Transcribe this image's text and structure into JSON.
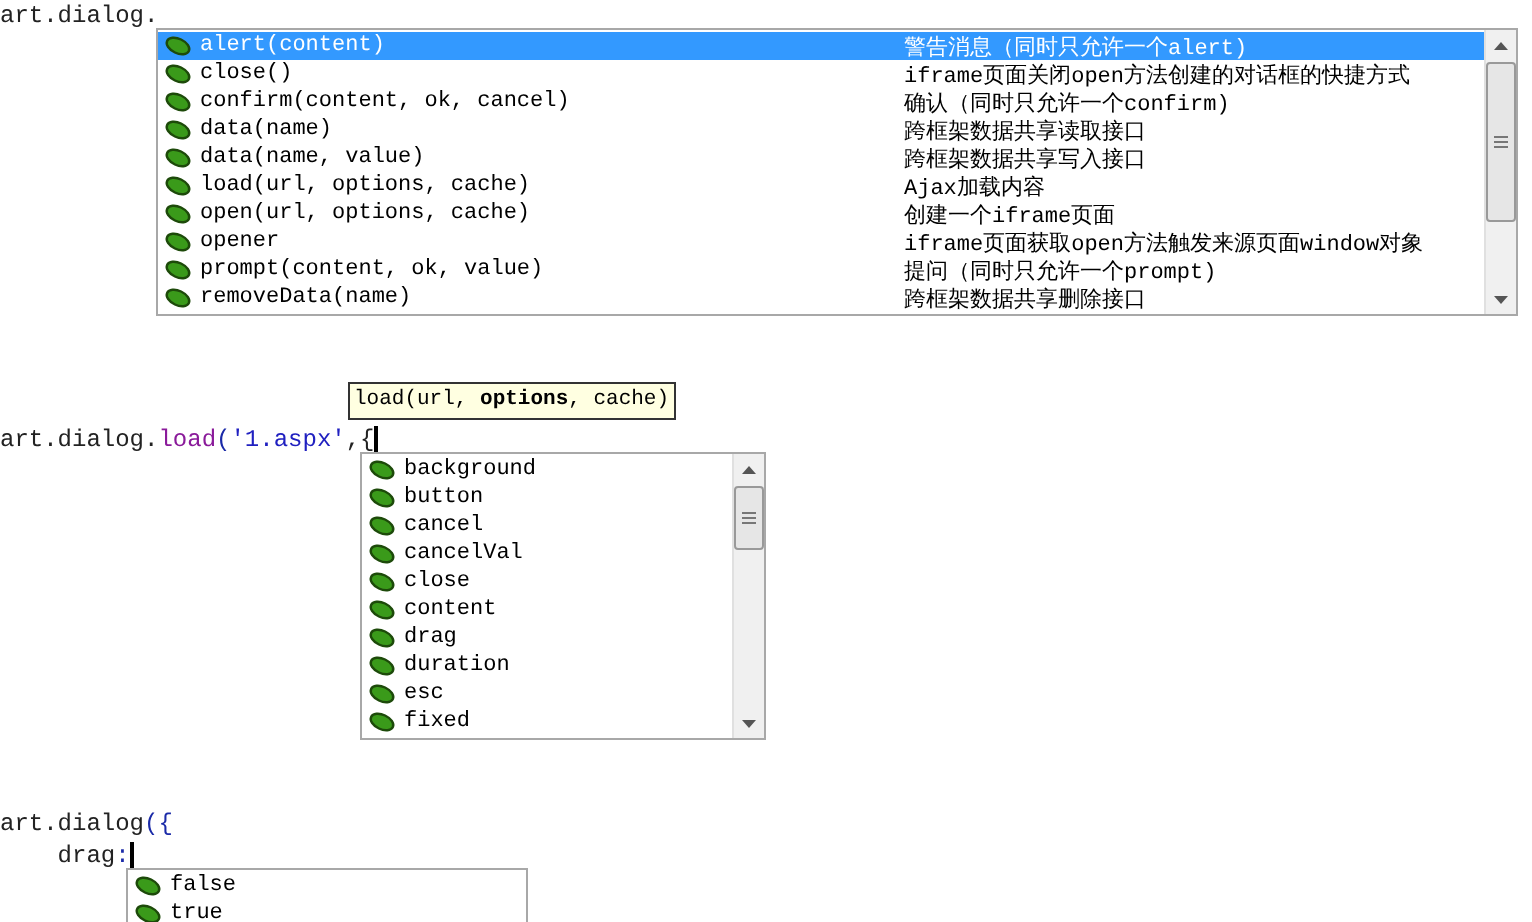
{
  "snippets": [
    {
      "code_lines": [
        [
          {
            "text": "art.dialog.",
            "kind": "plain"
          }
        ]
      ],
      "caret": false,
      "completion": {
        "scrollbar": true,
        "items": [
          {
            "name": "alert(content)",
            "description": "警告消息（同时只允许一个alert)",
            "selected": true
          },
          {
            "name": "close()",
            "description": "iframe页面关闭open方法创建的对话框的快捷方式",
            "selected": false
          },
          {
            "name": "confirm(content, ok, cancel)",
            "description": "确认（同时只允许一个confirm)",
            "selected": false
          },
          {
            "name": "data(name)",
            "description": "跨框架数据共享读取接口",
            "selected": false
          },
          {
            "name": "data(name, value)",
            "description": "跨框架数据共享写入接口",
            "selected": false
          },
          {
            "name": "load(url, options, cache)",
            "description": "Ajax加载内容",
            "selected": false
          },
          {
            "name": "open(url, options, cache)",
            "description": "创建一个iframe页面",
            "selected": false
          },
          {
            "name": "opener",
            "description": "iframe页面获取open方法触发来源页面window对象",
            "selected": false
          },
          {
            "name": "prompt(content, ok, value)",
            "description": "提问（同时只允许一个prompt)",
            "selected": false
          },
          {
            "name": "removeData(name)",
            "description": "跨框架数据共享删除接口",
            "selected": false
          }
        ]
      }
    },
    {
      "tooltip": "load(url, **options**, cache)",
      "code_lines": [
        [
          {
            "text": "art.dialog.",
            "kind": "plain"
          },
          {
            "text": "load",
            "kind": "method"
          },
          {
            "text": "(",
            "kind": "bracket"
          },
          {
            "text": "'1.aspx'",
            "kind": "string"
          },
          {
            "text": ",{",
            "kind": "plain"
          }
        ]
      ],
      "caret": true,
      "completion": {
        "scrollbar": true,
        "items": [
          {
            "name": "background",
            "selected": false
          },
          {
            "name": "button",
            "selected": false
          },
          {
            "name": "cancel",
            "selected": false
          },
          {
            "name": "cancelVal",
            "selected": false
          },
          {
            "name": "close",
            "selected": false
          },
          {
            "name": "content",
            "selected": false
          },
          {
            "name": "drag",
            "selected": false
          },
          {
            "name": "duration",
            "selected": false
          },
          {
            "name": "esc",
            "selected": false
          },
          {
            "name": "fixed",
            "selected": false
          }
        ]
      }
    },
    {
      "code_lines": [
        [
          {
            "text": "art.dialog",
            "kind": "plain"
          },
          {
            "text": "({",
            "kind": "bracket"
          }
        ],
        [
          {
            "text": "    drag",
            "kind": "plain"
          },
          {
            "text": ":",
            "kind": "bracket"
          }
        ]
      ],
      "caret": true,
      "completion": {
        "scrollbar": false,
        "items": [
          {
            "name": "false",
            "selected": false
          },
          {
            "name": "true",
            "selected": false
          }
        ]
      }
    }
  ]
}
